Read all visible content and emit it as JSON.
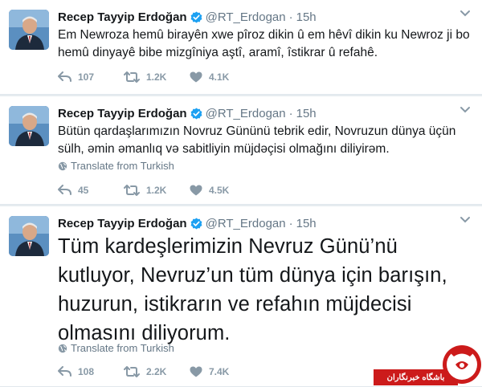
{
  "tweets": [
    {
      "name": "Recep Tayyip Erdoğan",
      "handle": "@RT_Erdogan",
      "separator": "·",
      "time": "15h",
      "text": "Em Newroza hemû birayên xwe pîroz dikin û em hêvî dikin ku Newroz ji bo hemû dinyayê bibe mizgîniya aştî, aramî, îstikrar û refahê.",
      "translate": "",
      "replies": "107",
      "retweets": "1.2K",
      "likes": "4.1K"
    },
    {
      "name": "Recep Tayyip Erdoğan",
      "handle": "@RT_Erdogan",
      "separator": "·",
      "time": "15h",
      "text": "Bütün qardaşlarımızın Novruz Gününü tebrik edir, Novruzun dünya üçün sülh, əmin əmanlıq və sabitliyin müjdəçisi olmağını diliyirəm.",
      "translate": "Translate from Turkish",
      "replies": "45",
      "retweets": "1.2K",
      "likes": "4.5K"
    },
    {
      "name": "Recep Tayyip Erdoğan",
      "handle": "@RT_Erdogan",
      "separator": "·",
      "time": "15h",
      "text": "Tüm kardeşlerimizin Nevruz Günü’nü kutluyor, Nevruz’un tüm dünya için barışın, huzurun, istikrarın ve refahın müjdecisi olmasını diliyorum.",
      "translate": "Translate from Turkish",
      "replies": "108",
      "retweets": "2.2K",
      "likes": "7.4K"
    }
  ],
  "watermark": {
    "text": "باشگاه خبرنگاران"
  },
  "colors": {
    "verified": "#1da1f2",
    "meta": "#657786",
    "action": "#8899a6",
    "watermark": "#cc1b1b"
  },
  "icons": [
    "verified-icon",
    "chevron-down-icon",
    "globe-icon",
    "reply-icon",
    "retweet-icon",
    "heart-icon"
  ]
}
